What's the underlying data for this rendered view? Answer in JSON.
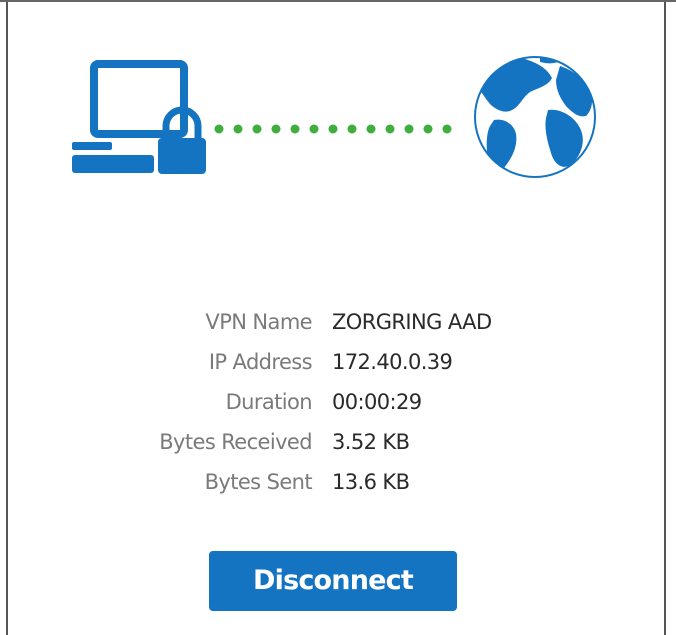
{
  "colors": {
    "icon_blue": "#1574c2",
    "connection_dots": "#3fae3f",
    "label_gray": "#7a7a7a",
    "value_dark": "#2a2a2a",
    "button_bg": "#1574c2",
    "button_text": "#ffffff"
  },
  "icons": {
    "computer": "computer-lock-icon",
    "connection": "connection-dots",
    "globe": "globe-icon"
  },
  "details": [
    {
      "label": "VPN Name",
      "value": "ZORGRING AAD"
    },
    {
      "label": "IP Address",
      "value": "172.40.0.39"
    },
    {
      "label": "Duration",
      "value": "00:00:29"
    },
    {
      "label": "Bytes Received",
      "value": "3.52 KB"
    },
    {
      "label": "Bytes Sent",
      "value": "13.6 KB"
    }
  ],
  "actions": {
    "disconnect_label": "Disconnect"
  }
}
